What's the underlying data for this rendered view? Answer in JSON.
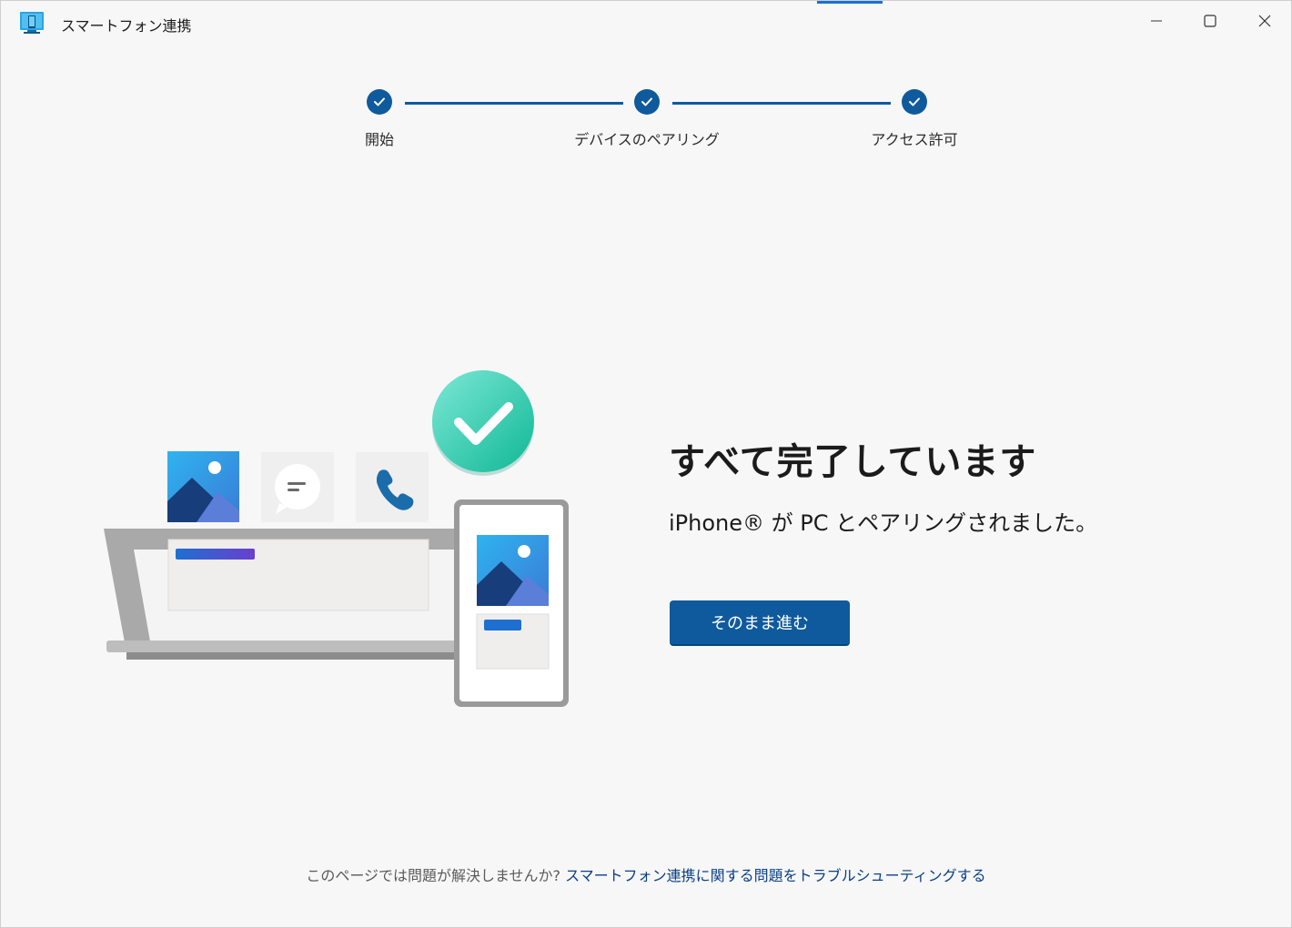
{
  "window": {
    "title": "スマートフォン連携",
    "accent_color": "#0f5a9c"
  },
  "stepper": {
    "steps": [
      {
        "label": "開始",
        "completed": true
      },
      {
        "label": "デバイスのペアリング",
        "completed": true
      },
      {
        "label": "アクセス許可",
        "completed": true
      }
    ]
  },
  "main": {
    "headline": "すべて完了しています",
    "subtext": "iPhone® が PC とペアリングされました。",
    "continue_label": "そのまま進む"
  },
  "footer": {
    "question": "このページでは問題が解決しませんか? ",
    "link": "スマートフォン連携に関する問題をトラブルシューティングする"
  },
  "icons": {
    "app": "phone-link-app-icon",
    "minimize": "minimize-icon",
    "maximize": "maximize-icon",
    "close": "close-icon",
    "check": "checkmark-icon"
  }
}
